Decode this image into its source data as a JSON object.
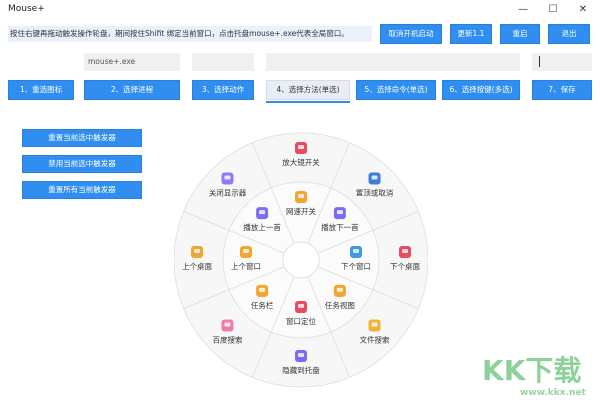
{
  "window": {
    "title": "Mouse+",
    "minimize": "—",
    "maximize": "☐",
    "close": "✕"
  },
  "hint": "按住右键再拖动触发操作轮盘，期间按住Shifit 绑定当前窗口，点击托盘mouse+.exe代表全局窗口。",
  "top_buttons": {
    "cancel_autostart": "取消开机启动",
    "update": "更新1.1",
    "restart": "重启",
    "exit": "退出"
  },
  "fields": {
    "process_value": "mouse+.exe",
    "key_value": "|"
  },
  "steps": [
    {
      "label": "1、重选图标"
    },
    {
      "label": "2、选择进程"
    },
    {
      "label": "3、选择动作"
    },
    {
      "label": "4、选择方法(单选)"
    },
    {
      "label": "5、选择命令(单选)"
    },
    {
      "label": "6、选择按键(多选)"
    },
    {
      "label": "7、保存"
    }
  ],
  "side_buttons": [
    {
      "label": "重置当前选中触发器"
    },
    {
      "label": "禁用当前选中触发器"
    },
    {
      "label": "重置所有当前触发器"
    }
  ],
  "wheel": {
    "outer": [
      {
        "label": "放大镜开关",
        "icon": "heart-icon",
        "color": "#e84a5f"
      },
      {
        "label": "置顶或取消",
        "icon": "graduation-cap-icon",
        "color": "#3b7dd8"
      },
      {
        "label": "下个桌面",
        "icon": "edit-icon",
        "color": "#e84a5f"
      },
      {
        "label": "文件搜索",
        "icon": "document-icon",
        "color": "#f2b233"
      },
      {
        "label": "隐藏到托盘",
        "icon": "layers-icon",
        "color": "#7b6cf2"
      },
      {
        "label": "百度搜索",
        "icon": "calendar-icon",
        "color": "#f07aa8"
      },
      {
        "label": "上个桌面",
        "icon": "box-icon",
        "color": "#f2a531"
      },
      {
        "label": "关闭显示器",
        "icon": "video-icon",
        "color": "#8b7cf6"
      }
    ],
    "inner": [
      {
        "label": "网速开关",
        "icon": "bulb-icon",
        "color": "#f2a531"
      },
      {
        "label": "播放下一首",
        "icon": "music-icon",
        "color": "#7b6cf2"
      },
      {
        "label": "下个窗口",
        "icon": "window-icon",
        "color": "#3b9ae8"
      },
      {
        "label": "任务视图",
        "icon": "folder-icon",
        "color": "#f2a531"
      },
      {
        "label": "窗口定位",
        "icon": "heart-icon",
        "color": "#e84a5f"
      },
      {
        "label": "任务栏",
        "icon": "tag-icon",
        "color": "#f2a531"
      },
      {
        "label": "上个窗口",
        "icon": "camera-icon",
        "color": "#f2a531"
      },
      {
        "label": "播放上一首",
        "icon": "music-icon",
        "color": "#7b6cf2"
      }
    ]
  },
  "watermark": {
    "logo": "KK下载",
    "url": "www.kkx.net"
  }
}
